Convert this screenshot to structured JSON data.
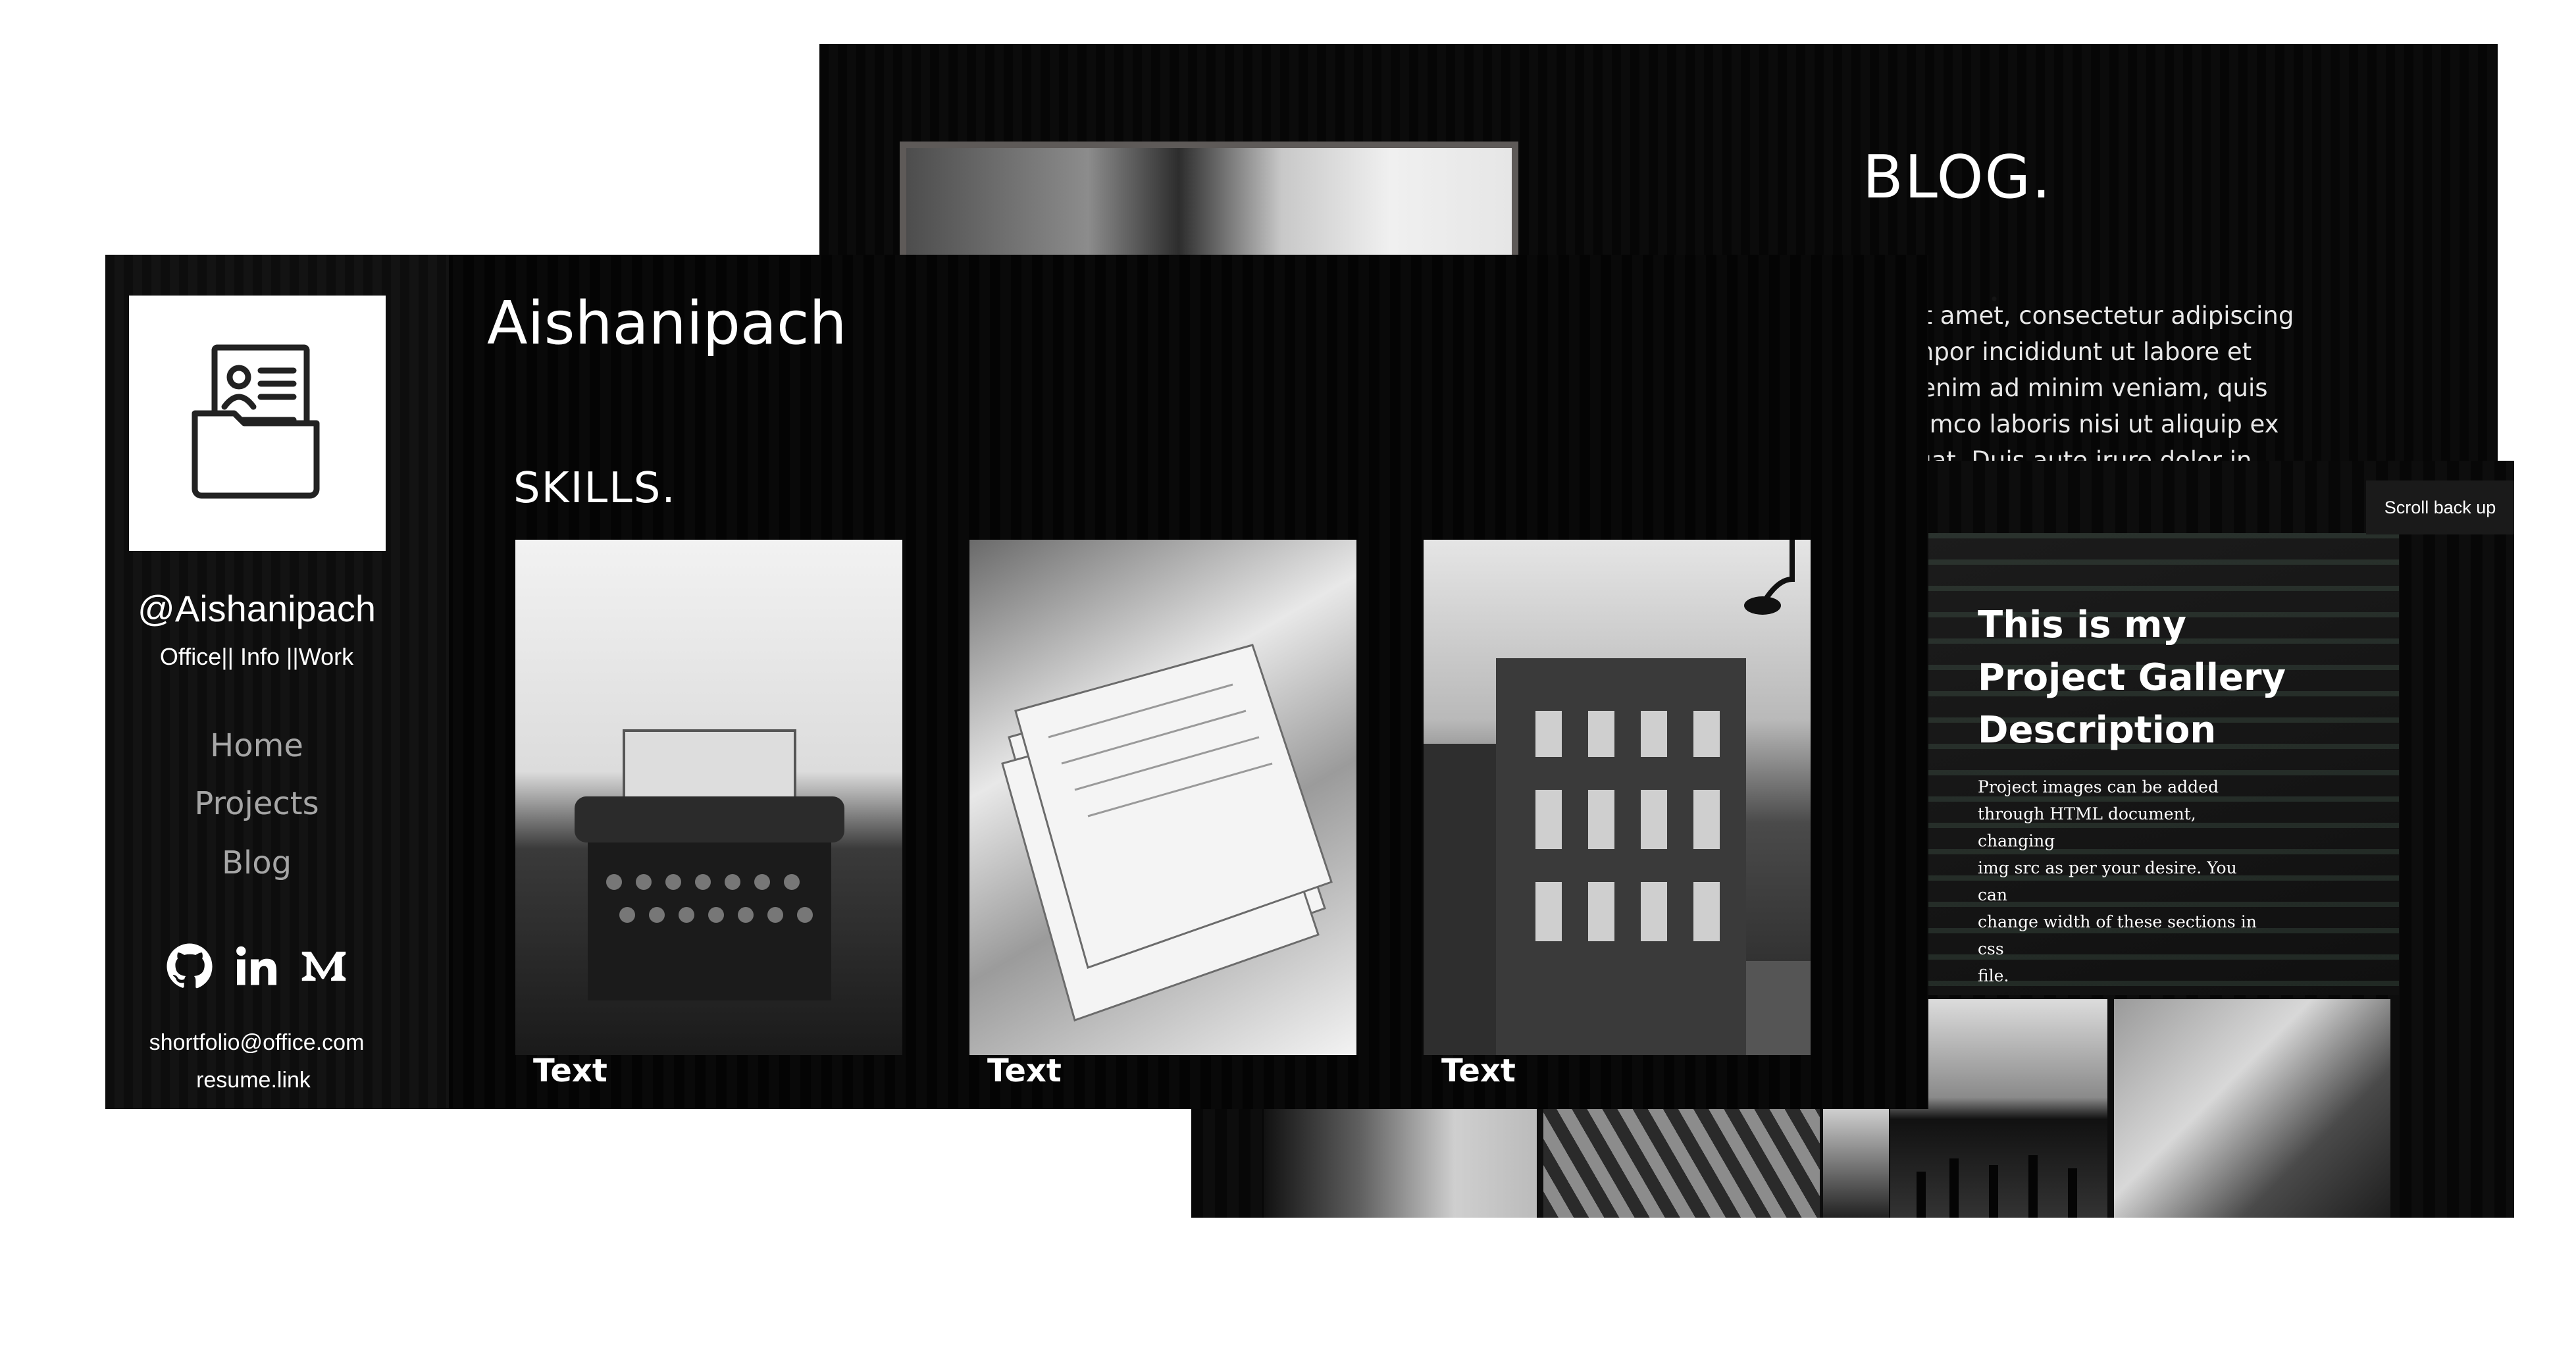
{
  "blog": {
    "title": "BLOG.",
    "lines": [
      "r sit amet, consectetur adipiscing",
      " tempor incididunt ut labore et",
      " Ut enim ad minim veniam, quis",
      " ullamco laboris nisi ut aliquip ex",
      "equat. Duis aute irure dolor in"
    ]
  },
  "gallery": {
    "scroll_button": "Scroll back up",
    "title_lines": [
      "This is my",
      "Project Gallery",
      "Description"
    ],
    "body_lines": [
      "Project images can be added",
      "through HTML document, changing",
      "img src as per your desire. You can",
      "change width of these sections in css",
      "file."
    ]
  },
  "profile": {
    "site_title": "Aishanipach",
    "handle": "@Aishanipach",
    "tagline": "Office|| Info ||Work",
    "nav": [
      "Home",
      "Projects",
      "Blog"
    ],
    "socials": [
      "github-icon",
      "linkedin-icon",
      "medium-icon"
    ],
    "email": "shortfolio@office.com",
    "resume": "resume.link"
  },
  "skills": {
    "title": "SKILLS.",
    "cards": [
      {
        "caption": "Text"
      },
      {
        "caption": "Text"
      },
      {
        "caption": "Text"
      }
    ]
  },
  "colors": {
    "background": "#000000",
    "text": "#ffffff",
    "nav_text": "#a6a6a6",
    "page": "#ffffff"
  }
}
